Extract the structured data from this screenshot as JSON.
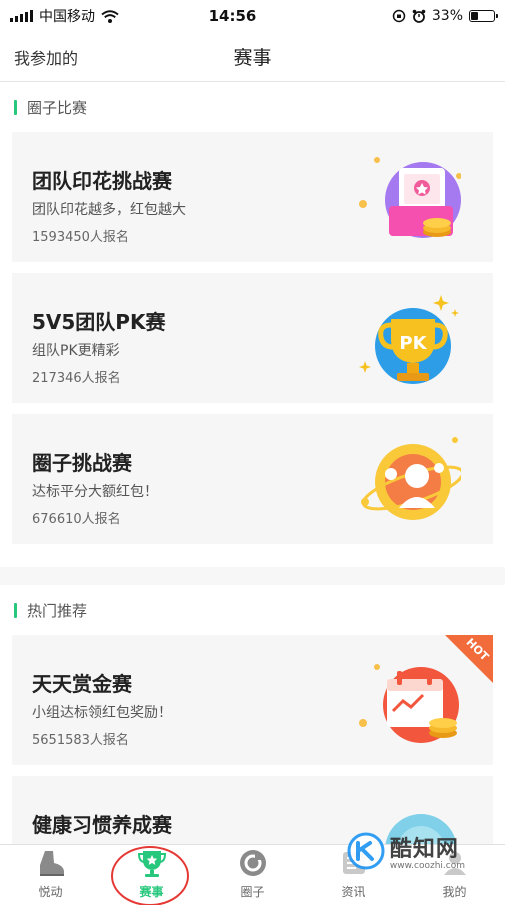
{
  "status_bar": {
    "carrier": "中国移动",
    "time": "14:56",
    "battery": "33%",
    "battery_level": 0.33
  },
  "nav": {
    "left_label": "我参加的",
    "title": "赛事"
  },
  "sections": [
    {
      "title": "圈子比赛",
      "cards": [
        {
          "title": "团队印花挑战赛",
          "desc": "团队印花越多，红包越大",
          "count": "1593450人报名",
          "art": "stamp-ticket-icon"
        },
        {
          "title": "5V5团队PK赛",
          "desc": "组队PK更精彩",
          "count": "217346人报名",
          "art": "pk-trophy-icon"
        },
        {
          "title": "圈子挑战赛",
          "desc": "达标平分大额红包！",
          "count": "676610人报名",
          "art": "circle-people-icon"
        }
      ]
    },
    {
      "title": "热门推荐",
      "cards": [
        {
          "title": "天天赏金赛",
          "desc": "小组达标领红包奖励！",
          "count": "5651583人报名",
          "art": "calendar-coins-icon",
          "badge": "HOT"
        },
        {
          "title": "健康习惯养成赛",
          "art": "habit-icon"
        }
      ]
    }
  ],
  "tabs": [
    {
      "label": "悦动",
      "icon": "shoe-icon",
      "active": false
    },
    {
      "label": "赛事",
      "icon": "trophy-icon",
      "active": true
    },
    {
      "label": "圈子",
      "icon": "circle-icon",
      "active": false
    },
    {
      "label": "资讯",
      "icon": "news-icon",
      "active": false
    },
    {
      "label": "我的",
      "icon": "profile-icon",
      "active": false
    }
  ],
  "watermark": {
    "name": "酷知网",
    "url": "www.coozhi.com"
  },
  "colors": {
    "accent": "#27c87d",
    "highlight_circle": "#e53935",
    "hot_badge": "#f26b3a"
  }
}
